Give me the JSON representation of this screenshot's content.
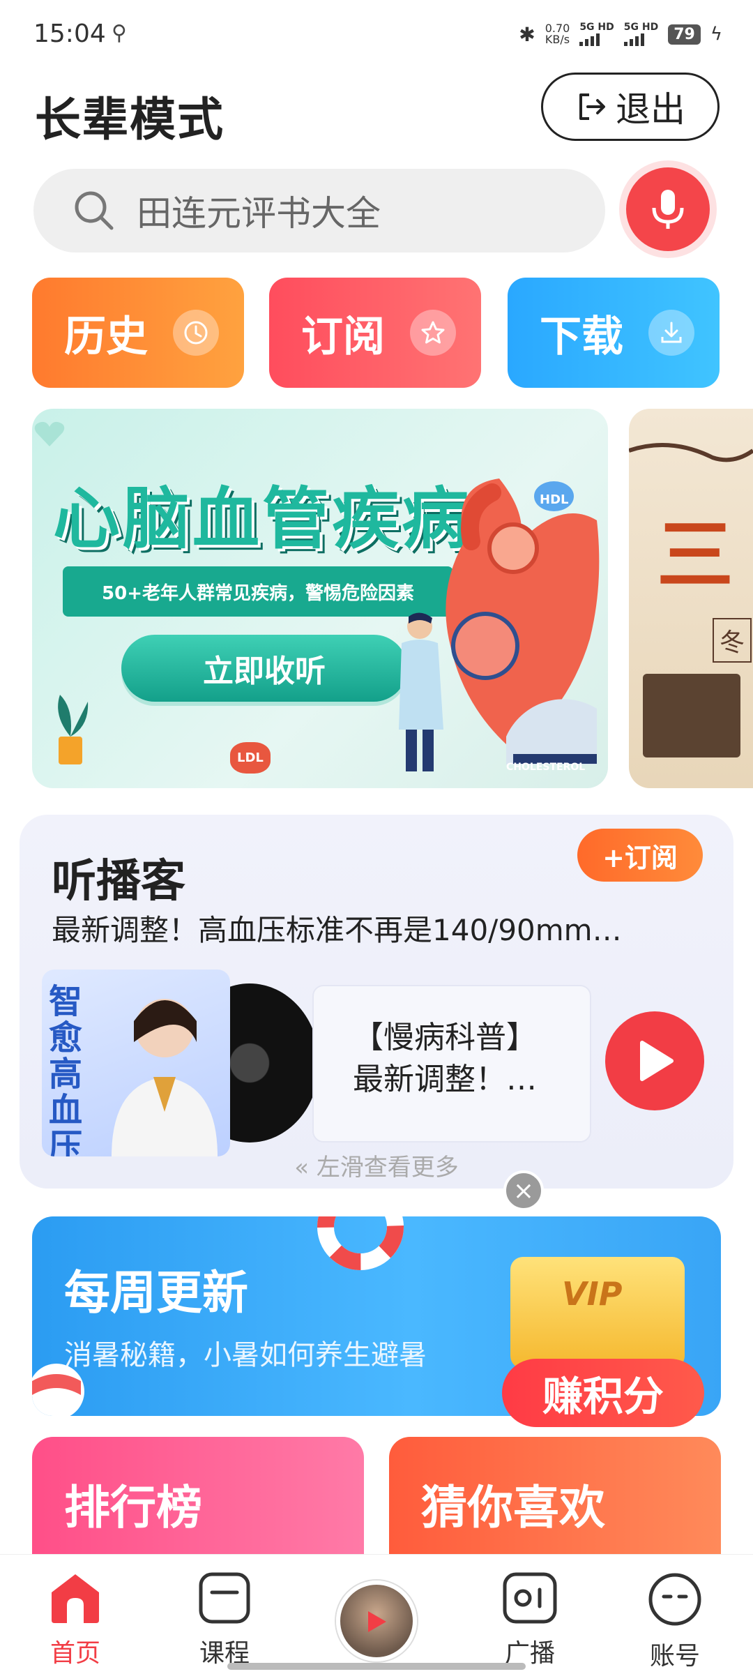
{
  "status": {
    "time": "15:04",
    "speed_value": "0.70",
    "speed_unit": "KB/s",
    "sim1": "5G HD",
    "sim2": "5G HD",
    "battery": "79"
  },
  "header": {
    "title": "长辈模式",
    "logout_label": "退出"
  },
  "search": {
    "placeholder": "田连元评书大全"
  },
  "quick": {
    "history": "历史",
    "subscribe": "订阅",
    "download": "下载"
  },
  "banner": {
    "heading": "心脑血管疾病",
    "subheading": "50+老年人群常见疾病，警惕危险因素",
    "cta": "立即收听",
    "hdl": "HDL",
    "ldl": "LDL",
    "cholesterol": "CHOLESTEROL",
    "next_partial": "三",
    "next_partial2": "冬"
  },
  "podcast": {
    "title": "听播客",
    "subscribe_label": "+订阅",
    "headline": "最新调整！高血压标准不再是140/90mm…",
    "cover_title": "智愈高血压",
    "episode_line1": "【慢病科普】",
    "episode_line2": "最新调整！…",
    "swipe_hint": "左滑查看更多"
  },
  "weekly": {
    "title": "每周更新",
    "subtitle": "消暑秘籍，小暑如何养生避暑",
    "earn": "赚积分",
    "vip": "VIP"
  },
  "cards": {
    "rank": "排行榜",
    "guess": "猜你喜欢"
  },
  "nav": {
    "home": "首页",
    "course": "课程",
    "radio": "广播",
    "account": "账号"
  },
  "colors": {
    "accent": "#f23d45",
    "teal": "#1fb89e"
  }
}
